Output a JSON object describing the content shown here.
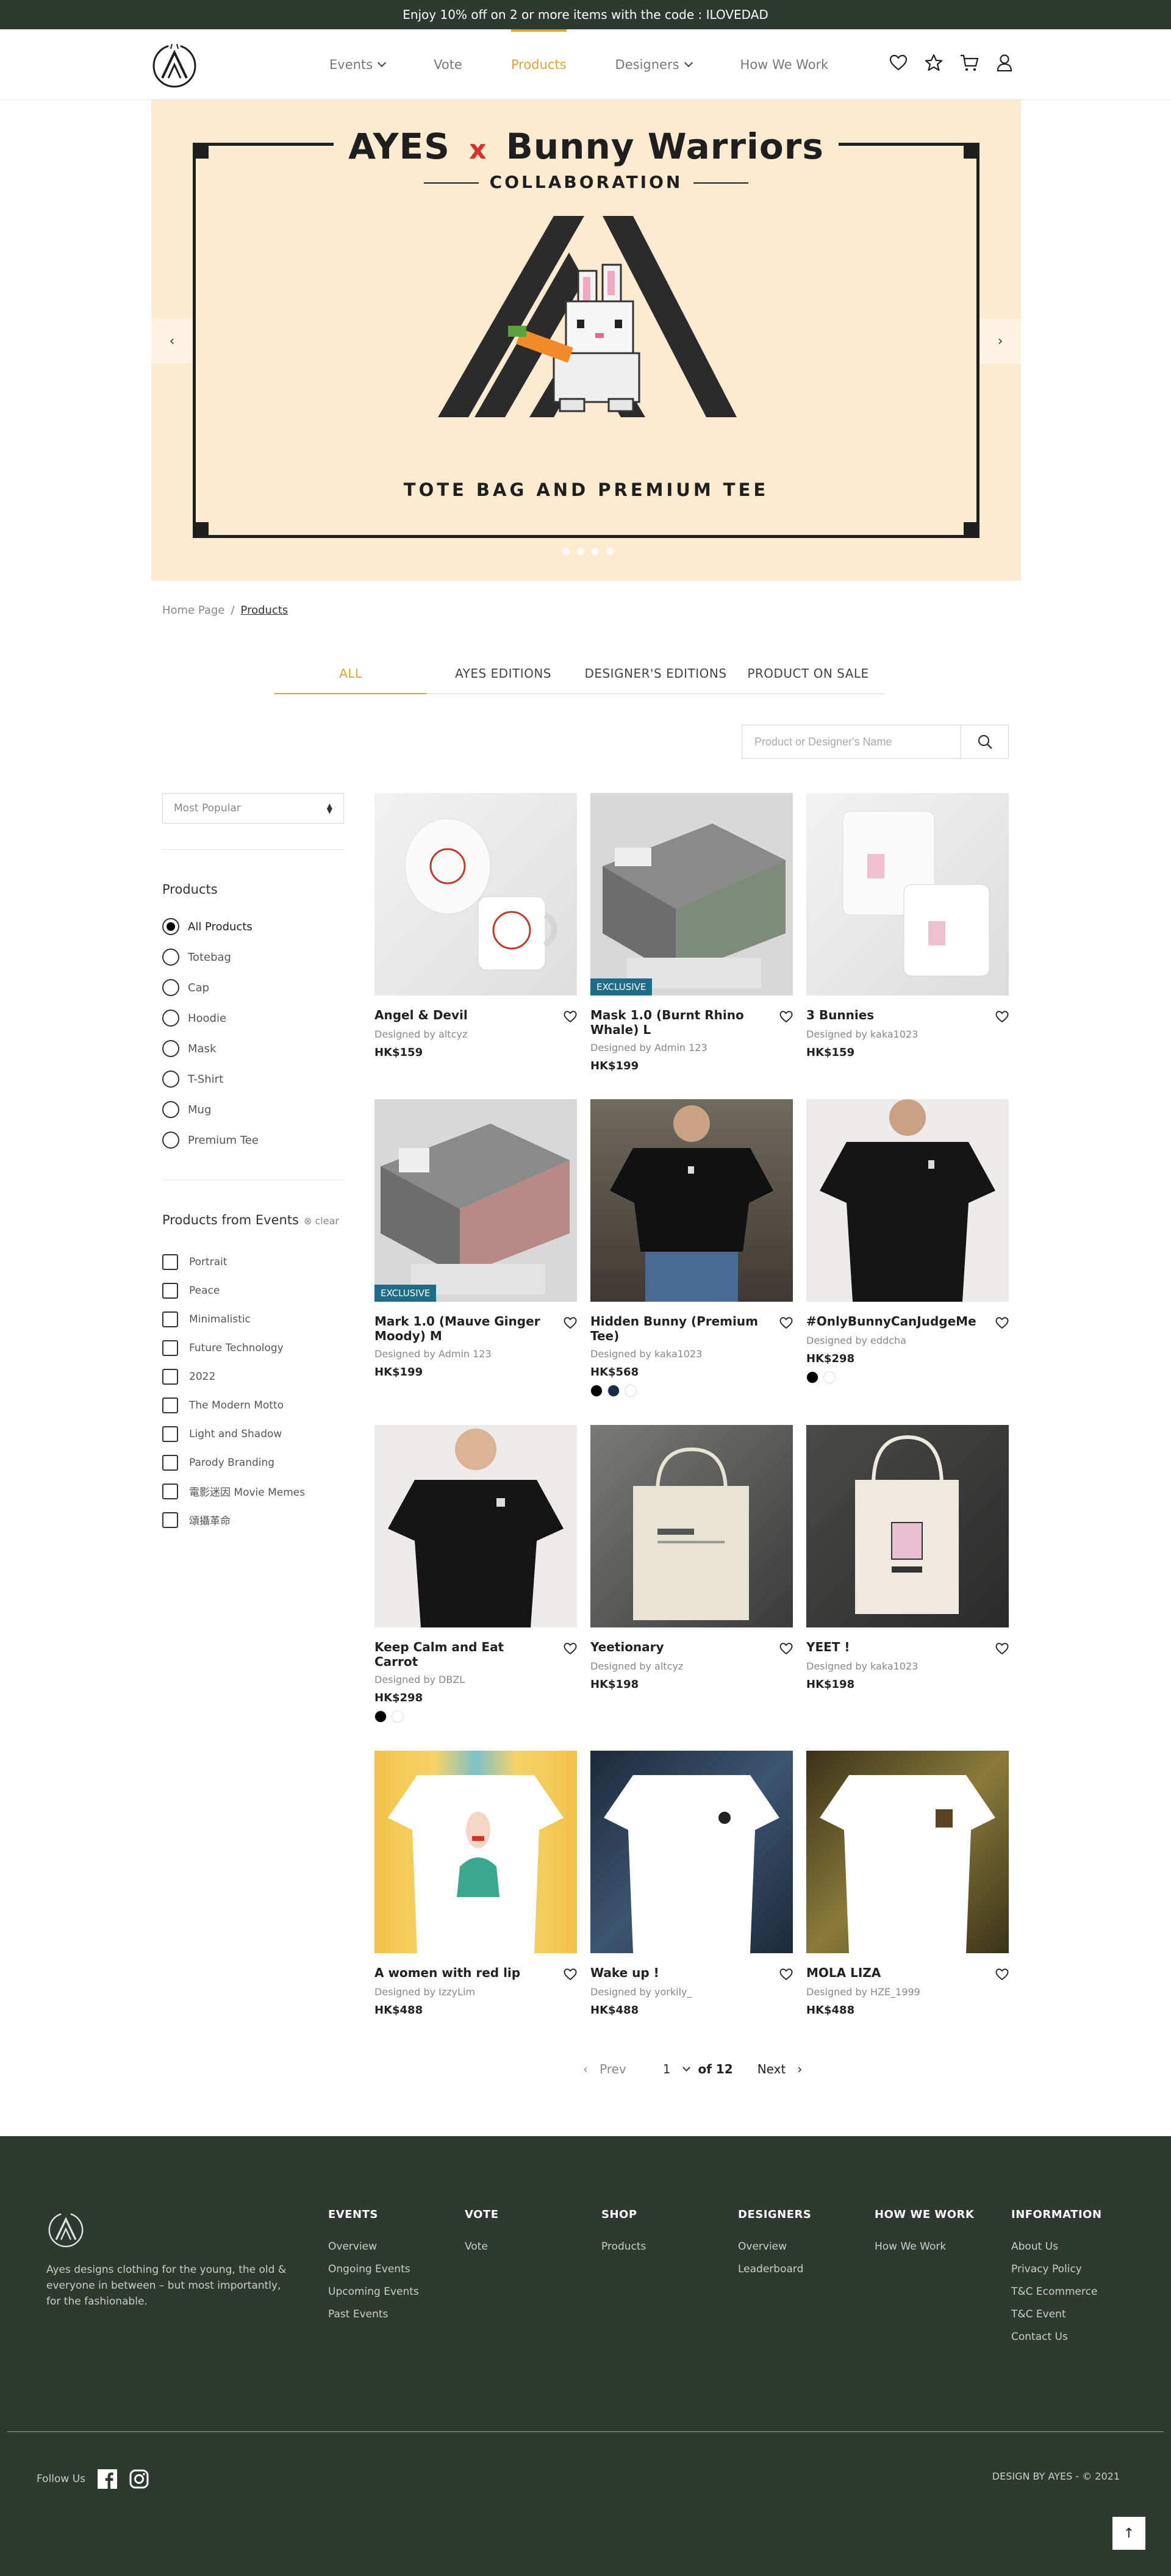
{
  "announcement": "Enjoy 10% off on 2 or more items with the code : ILOVEDAD",
  "nav": {
    "items": [
      {
        "label": "Events",
        "dropdown": true,
        "active": false
      },
      {
        "label": "Vote",
        "dropdown": false,
        "active": false
      },
      {
        "label": "Products",
        "dropdown": false,
        "active": true
      },
      {
        "label": "Designers",
        "dropdown": true,
        "active": false
      },
      {
        "label": "How We Work",
        "dropdown": false,
        "active": false
      }
    ],
    "icons": [
      "heart-icon",
      "star-icon",
      "cart-icon",
      "user-icon"
    ]
  },
  "hero": {
    "brand_left": "AYES",
    "x": "x",
    "brand_right": "Bunny Warriors",
    "collab": "COLLABORATION",
    "subtitle": "TOTE  BAG  AND  PREMIUM TEE",
    "slide_count": 4,
    "prev": "‹",
    "next": "›"
  },
  "breadcrumb": {
    "home": "Home Page",
    "sep": "/",
    "current": "Products"
  },
  "tabs": [
    "ALL",
    "AYES EDITIONS",
    "DESIGNER'S EDITIONS",
    "PRODUCT ON SALE"
  ],
  "search": {
    "placeholder": "Product or Designer's Name"
  },
  "sidebar": {
    "sort": "Most Popular",
    "products_heading": "Products",
    "product_types": [
      "All Products",
      "Totebag",
      "Cap",
      "Hoodie",
      "Mask",
      "T-Shirt",
      "Mug",
      "Premium Tee"
    ],
    "selected_type": "All Products",
    "events_heading": "Products from Events",
    "clear": "clear",
    "events": [
      "Portrait",
      "Peace",
      "Minimalistic",
      "Future Technology",
      "2022",
      "The Modern Motto",
      "Light and Shadow",
      "Parody Branding",
      "電影迷因 Movie Memes",
      "頌攝革命"
    ]
  },
  "products": [
    {
      "title": "Angel & Devil",
      "designer": "Designed by altcyz",
      "price": "HK$159",
      "badge": "",
      "swatches": []
    },
    {
      "title": "Mask 1.0 (Burnt Rhino Whale) L",
      "designer": "Designed by Admin 123",
      "price": "HK$199",
      "badge": "EXCLUSIVE",
      "swatches": []
    },
    {
      "title": "3 Bunnies",
      "designer": "Designed by kaka1023",
      "price": "HK$159",
      "badge": "",
      "swatches": []
    },
    {
      "title": "Mark 1.0 (Mauve Ginger Moody) M",
      "designer": "Designed by Admin 123",
      "price": "HK$199",
      "badge": "EXCLUSIVE",
      "swatches": []
    },
    {
      "title": "Hidden Bunny (Premium Tee)",
      "designer": "Designed by kaka1023",
      "price": "HK$568",
      "badge": "",
      "swatches": [
        "#000000",
        "#1e2a4a",
        "#ffffff"
      ]
    },
    {
      "title": "#OnlyBunnyCanJudgeMe",
      "designer": "Designed by eddcha",
      "price": "HK$298",
      "badge": "",
      "swatches": [
        "#000000",
        "#ffffff"
      ]
    },
    {
      "title": "Keep Calm and Eat Carrot",
      "designer": "Designed by DBZL",
      "price": "HK$298",
      "badge": "",
      "swatches": [
        "#000000",
        "#ffffff"
      ]
    },
    {
      "title": "Yeetionary",
      "designer": "Designed by altcyz",
      "price": "HK$198",
      "badge": "",
      "swatches": []
    },
    {
      "title": "YEET !",
      "designer": "Designed by kaka1023",
      "price": "HK$198",
      "badge": "",
      "swatches": []
    },
    {
      "title": "A women with red lip",
      "designer": "Designed by IzzyLim",
      "price": "HK$488",
      "badge": "",
      "swatches": []
    },
    {
      "title": "Wake up !",
      "designer": "Designed by yorkily_",
      "price": "HK$488",
      "badge": "",
      "swatches": []
    },
    {
      "title": "MOLA LIZA",
      "designer": "Designed by HZE_1999",
      "price": "HK$488",
      "badge": "",
      "swatches": []
    }
  ],
  "pagination": {
    "prev": "Prev",
    "page": "1",
    "of": "of 12",
    "next": "Next"
  },
  "footer": {
    "about": "Ayes designs clothing for the young, the old & everyone in between – but most importantly, for the fashionable.",
    "columns": [
      {
        "title": "EVENTS",
        "links": [
          "Overview",
          "Ongoing Events",
          "Upcoming Events",
          "Past Events"
        ]
      },
      {
        "title": "VOTE",
        "links": [
          "Vote"
        ]
      },
      {
        "title": "SHOP",
        "links": [
          "Products"
        ]
      },
      {
        "title": "DESIGNERS",
        "links": [
          "Overview",
          "Leaderboard"
        ]
      },
      {
        "title": "HOW WE WORK",
        "links": [
          "How We Work"
        ]
      },
      {
        "title": "INFORMATION",
        "links": [
          "About Us",
          "Privacy Policy",
          "T&C Ecommerce",
          "T&C Event",
          "Contact Us"
        ]
      }
    ],
    "follow": "Follow Us",
    "credit": "DESIGN BY AYES - © 2021",
    "to_top": "↑"
  },
  "colors": {
    "accent": "#e1a23a",
    "dark_green": "#2e3a2f",
    "hero_bg": "#fdebd1",
    "badge": "#1f6b8a",
    "x_red": "#d9312a"
  }
}
